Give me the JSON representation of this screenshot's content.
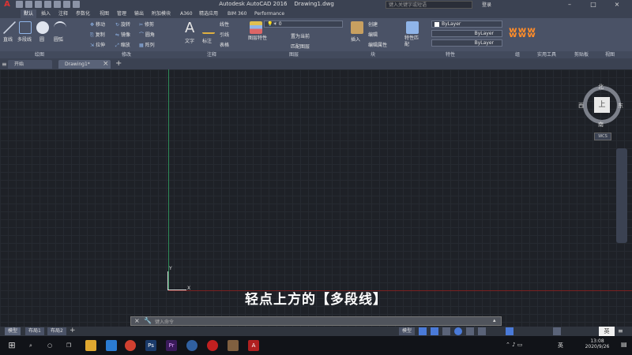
{
  "app": {
    "title": "Autodesk AutoCAD 2016",
    "filename": "Drawing1.dwg",
    "search_placeholder": "键入关键字或短语",
    "user": "登录"
  },
  "ribbon_tabs": [
    "默认",
    "插入",
    "注释",
    "参数化",
    "视图",
    "管理",
    "输出",
    "附加模块",
    "A360",
    "精选应用",
    "BIM 360",
    "Performance"
  ],
  "active_tab": "默认",
  "draw_tools": {
    "line": "直线",
    "polyline": "多段线",
    "circle": "圆",
    "arc": "圆弧"
  },
  "modify_tools": [
    "移动",
    "旋转",
    "修剪",
    "复制",
    "镜像",
    "圆角",
    "拉伸",
    "缩放",
    "阵列"
  ],
  "annotation_tools": {
    "text": "文字",
    "dimension": "标注",
    "leader": "引线",
    "table": "表格",
    "linear": "线性"
  },
  "layer_tools": {
    "layer_props": "图层特性",
    "current_layer": "0",
    "set_current": "置为当前",
    "match_layer": "匹配图层"
  },
  "block_tools": {
    "insert": "插入",
    "create": "创建",
    "edit": "编辑",
    "edit_attr": "编辑属性"
  },
  "properties": {
    "match": "特性匹配",
    "color": "ByLayer",
    "linetype": "ByLayer",
    "lineweight": "ByLayer"
  },
  "panel_titles": [
    "绘图",
    "修改",
    "注释",
    "图层",
    "块",
    "特性",
    "组",
    "实用工具",
    "剪贴板",
    "视图"
  ],
  "doc_tabs": [
    "开始",
    "Drawing1*"
  ],
  "viewcube": {
    "top": "上",
    "north": "北",
    "south": "南",
    "east": "东",
    "west": "西",
    "wcs": "WCS"
  },
  "ucs": {
    "x": "X",
    "y": "Y"
  },
  "caption": "轻点上方的【多段线】",
  "command_prompt": "键入命令",
  "layout_tabs": [
    "模型",
    "布局1",
    "布局2"
  ],
  "status": {
    "model": "模型",
    "lang": "英"
  },
  "clock": {
    "time": "13:08",
    "date": "2020/9/26"
  },
  "tray_lang": "英",
  "colors": {
    "accent": "#4a5266",
    "ucs_y": "#2e8b57",
    "ucs_x": "#a02828"
  }
}
